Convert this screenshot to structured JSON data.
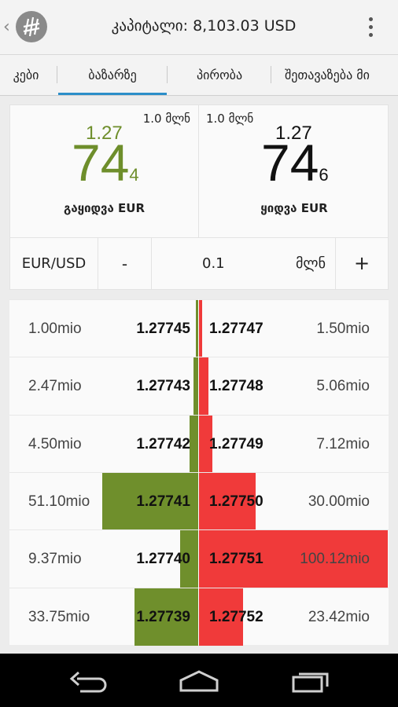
{
  "header": {
    "title": "კაპიტალი: 8,103.03 USD"
  },
  "tabs": [
    {
      "label": "კები",
      "active": false
    },
    {
      "label": "ბაზარზე",
      "active": true
    },
    {
      "label": "პირობა",
      "active": false
    },
    {
      "label": "შეთავაზება მი",
      "active": false
    }
  ],
  "quote": {
    "sell": {
      "lot": "1.0 მლნ",
      "prefix": "1.27",
      "big": "74",
      "small": "4",
      "label": "გაყიდვა EUR",
      "color": "#6e8e2b"
    },
    "buy": {
      "lot": "1.0 მლნ",
      "prefix": "1.27",
      "big": "74",
      "small": "6",
      "label": "ყიდვა EUR",
      "color": "#111111"
    }
  },
  "controls": {
    "pair": "EUR/USD",
    "minus": "-",
    "amount": "0.1",
    "unit": "მლნ",
    "plus": "+"
  },
  "depth": {
    "bid_color": "#6f8f2c",
    "ask_color": "#f03a3a",
    "rows": [
      {
        "bid_vol": "1.00mio",
        "bid_px": "1.27745",
        "ask_px": "1.27747",
        "ask_vol": "1.50mio",
        "bid_frac": 0.01,
        "ask_frac": 0.015
      },
      {
        "bid_vol": "2.47mio",
        "bid_px": "1.27743",
        "ask_px": "1.27748",
        "ask_vol": "5.06mio",
        "bid_frac": 0.025,
        "ask_frac": 0.051
      },
      {
        "bid_vol": "4.50mio",
        "bid_px": "1.27742",
        "ask_px": "1.27749",
        "ask_vol": "7.12mio",
        "bid_frac": 0.045,
        "ask_frac": 0.071
      },
      {
        "bid_vol": "51.10mio",
        "bid_px": "1.27741",
        "ask_px": "1.27750",
        "ask_vol": "30.00mio",
        "bid_frac": 0.51,
        "ask_frac": 0.3
      },
      {
        "bid_vol": "9.37mio",
        "bid_px": "1.27740",
        "ask_px": "1.27751",
        "ask_vol": "100.12mio",
        "bid_frac": 0.094,
        "ask_frac": 1.0
      },
      {
        "bid_vol": "33.75mio",
        "bid_px": "1.27739",
        "ask_px": "1.27752",
        "ask_vol": "23.42mio",
        "bid_frac": 0.337,
        "ask_frac": 0.234
      }
    ]
  },
  "icons": {
    "up": "chevron-left-icon",
    "logo": "app-logo-icon",
    "overflow": "overflow-menu-icon",
    "back": "back-icon",
    "home": "home-icon",
    "recents": "recents-icon"
  }
}
